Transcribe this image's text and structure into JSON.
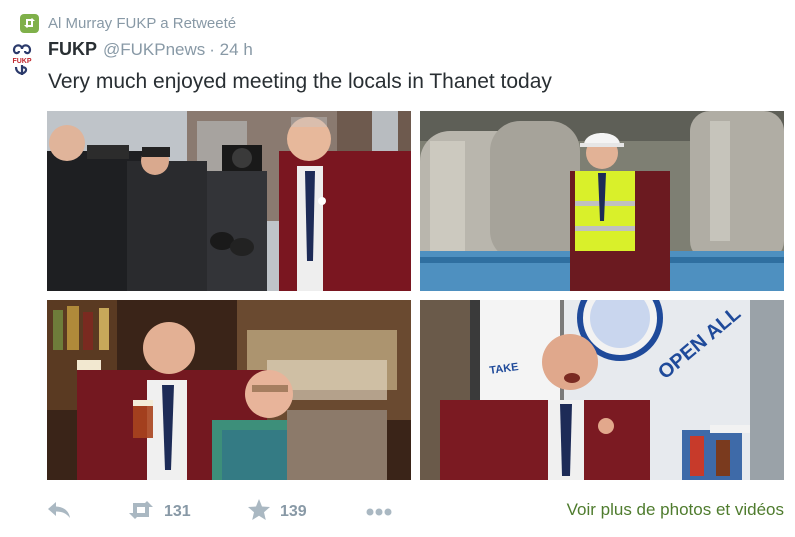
{
  "retweet": {
    "text": "Al Murray FUKP a Retweeté",
    "icon": "retweet-icon",
    "badge_color": "#7fb04a"
  },
  "author": {
    "name": "FUKP",
    "handle": "@FUKPnews",
    "time": "· 24 h",
    "avatar_label": "FUKP"
  },
  "tweet": {
    "text": "Very much enjoyed meeting the locals in Thanet today"
  },
  "photos": {
    "photo4_sign": "OPEN ALL",
    "photo4_window_text": "TAKE"
  },
  "actions": {
    "reply_icon": "reply-icon",
    "retweet_icon": "retweet-icon",
    "retweet_count": "131",
    "favorite_icon": "star-icon",
    "favorite_count": "139",
    "more_icon": "more-dots-icon",
    "more_media_link": "Voir plus de photos et vidéos"
  },
  "colors": {
    "text": "#292f33",
    "secondary": "#8899a6",
    "link_green": "#4f7c2e",
    "blazer": "#8b1c23"
  }
}
